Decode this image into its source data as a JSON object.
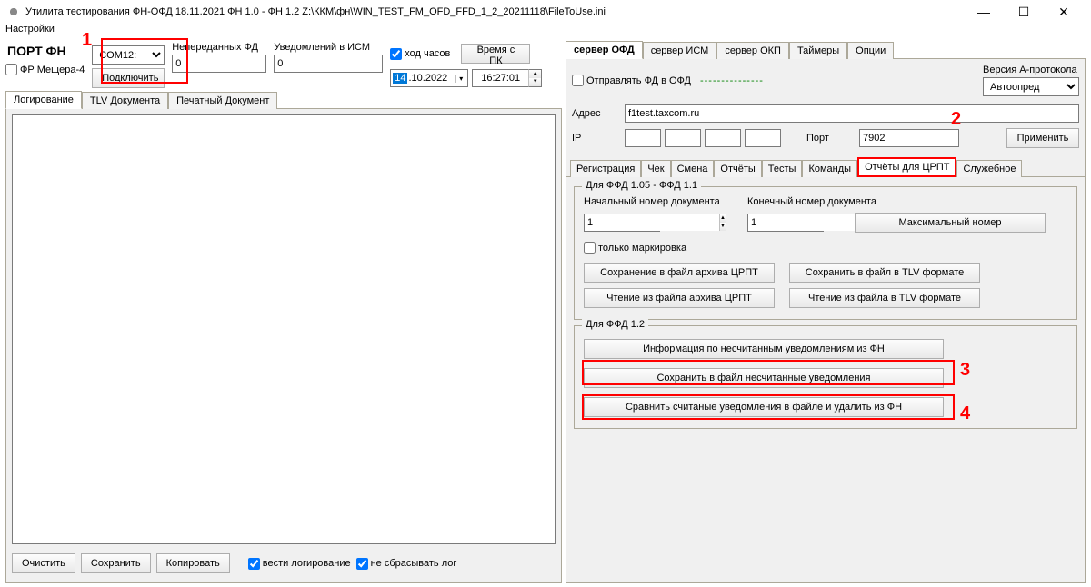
{
  "title": "Утилита тестирования ФН-ОФД  18.11.2021    ФН 1.0 - ФН 1.2        Z:\\ККМ\\фн\\WIN_TEST_FM_OFD_FFD_1_2_20211118\\FileToUse.ini",
  "menubar": {
    "settings": "Настройки"
  },
  "port": {
    "title": "ПОРТ ФН",
    "com": "COM12:",
    "connect": "Подключить",
    "fr_checkbox": "ФР Мещера-4"
  },
  "tx": {
    "unsent_fd_label": "Непереданных ФД",
    "unsent_fd_value": "0",
    "ism_notif_label": "Уведомлений в ИСМ",
    "ism_notif_value": "0",
    "clock_label": "ход часов",
    "pc_time_btn": "Время с ПК",
    "date": {
      "day": "14",
      "rest": ".10.2022"
    },
    "time": "16:27:01"
  },
  "left_tabs": {
    "log": "Логирование",
    "tlv": "TLV Документа",
    "print": "Печатный Документ"
  },
  "bottom": {
    "clear": "Очистить",
    "save": "Сохранить",
    "copy": "Копировать",
    "do_log": "вести логирование",
    "no_reset": "не сбрасывать лог"
  },
  "right_tabs": {
    "ofd": "сервер ОФД",
    "ism": "сервер ИСМ",
    "okp": "сервер ОКП",
    "timers": "Таймеры",
    "opts": "Опции"
  },
  "ofd": {
    "send_chk": "Отправлять ФД в ОФД",
    "dashes": "---------------",
    "version_label": "Версия А-протокола",
    "version_value": "Автоопред",
    "addr_label": "Адрес",
    "addr_value": "f1test.taxcom.ru",
    "ip_label": "IP",
    "port_label": "Порт",
    "port_value": "7902",
    "apply": "Применить"
  },
  "subtabs": {
    "reg": "Регистрация",
    "chk": "Чек",
    "shift": "Смена",
    "reports": "Отчёты",
    "tests": "Тесты",
    "cmds": "Команды",
    "crpt": "Отчёты для ЦРПТ",
    "service": "Служебное"
  },
  "crpt1": {
    "legend": "Для ФФД 1.05 - ФФД 1.1",
    "start_label": "Начальный номер документа",
    "end_label": "Конечный номер документа",
    "start_value": "1",
    "end_value": "1",
    "max_btn": "Максимальный номер",
    "only_mark": "только маркировка",
    "save_arch": "Сохранение в файл архива ЦРПТ",
    "save_tlv": "Сохранить в файл в TLV формате",
    "read_arch": "Чтение из файла архива ЦРПТ",
    "read_tlv": "Чтение из файла в TLV формате"
  },
  "crpt2": {
    "legend": "Для ФФД 1.2",
    "info_btn": "Информация по несчитанным уведомлениям из ФН",
    "save_unread": "Сохранить в файл несчитанные уведомления",
    "compare_delete": "Сравнить считаные уведомления в файле и удалить из ФН"
  },
  "annotations": {
    "a1": "1",
    "a2": "2",
    "a3": "3",
    "a4": "4"
  }
}
